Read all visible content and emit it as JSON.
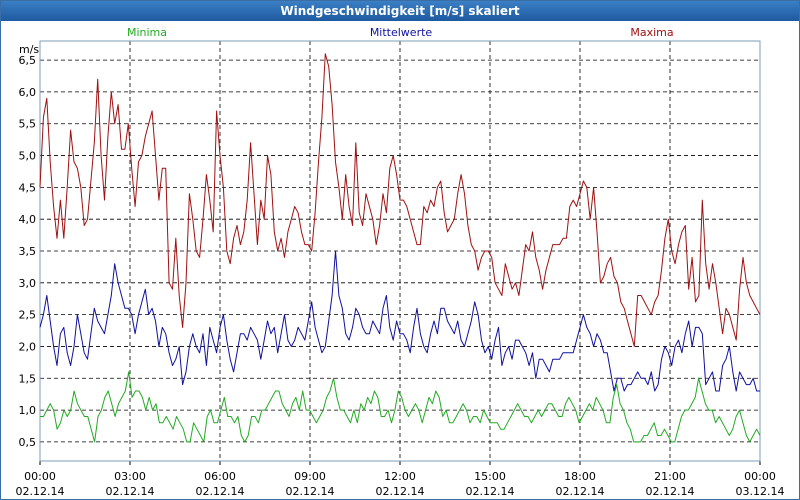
{
  "window": {
    "title": "Windgeschwindigkeit [m/s] skaliert"
  },
  "colors": {
    "minima": "#22aa22",
    "mittelwerte": "#1010a0",
    "maxima": "#a01010",
    "grid": "#000000"
  },
  "chart_data": {
    "type": "line",
    "title": "Windgeschwindigkeit [m/s] skaliert",
    "ylabel": "m/s",
    "xlabel": "",
    "ylim": [
      0.2,
      6.8
    ],
    "xlim": [
      0,
      24
    ],
    "grid": true,
    "legend": [
      "Minima",
      "Mittelwerte",
      "Maxima"
    ],
    "legend_placement": "top",
    "y_ticks": [
      "0,5",
      "1,0",
      "1,5",
      "2,0",
      "2,5",
      "3,0",
      "3,5",
      "4,0",
      "4,5",
      "5,0",
      "5,5",
      "6,0",
      "6,5"
    ],
    "y_tick_values": [
      0.5,
      1.0,
      1.5,
      2.0,
      2.5,
      3.0,
      3.5,
      4.0,
      4.5,
      5.0,
      5.5,
      6.0,
      6.5
    ],
    "x_ticks": [
      {
        "time": "00:00",
        "date": "02.12.14"
      },
      {
        "time": "03:00",
        "date": "02.12.14"
      },
      {
        "time": "06:00",
        "date": "02.12.14"
      },
      {
        "time": "09:00",
        "date": "02.12.14"
      },
      {
        "time": "12:00",
        "date": "02.12.14"
      },
      {
        "time": "15:00",
        "date": "02.12.14"
      },
      {
        "time": "18:00",
        "date": "02.12.14"
      },
      {
        "time": "21:00",
        "date": "02.12.14"
      },
      {
        "time": "00:00",
        "date": "03.12.14"
      }
    ],
    "x_tick_values": [
      0,
      3,
      6,
      9,
      12,
      15,
      18,
      21,
      24
    ],
    "sample_interval_minutes": 10,
    "series": [
      {
        "name": "Maxima",
        "color": "#a01010",
        "values": [
          4.5,
          5.6,
          5.9,
          4.9,
          4.2,
          3.7,
          4.3,
          3.7,
          4.5,
          5.4,
          4.9,
          4.8,
          4.5,
          3.9,
          4.0,
          4.6,
          5.2,
          6.2,
          5.0,
          4.3,
          5.3,
          6.0,
          5.5,
          5.8,
          5.1,
          5.1,
          5.5,
          4.8,
          4.2,
          4.9,
          5.0,
          5.3,
          5.5,
          5.7,
          5.0,
          4.3,
          4.8,
          4.8,
          3.0,
          2.9,
          3.7,
          2.8,
          2.3,
          3.0,
          4.4,
          4.0,
          3.5,
          3.4,
          4.0,
          4.7,
          4.3,
          3.8,
          5.7,
          5.0,
          4.5,
          3.5,
          3.3,
          3.7,
          3.9,
          3.6,
          3.8,
          4.3,
          5.2,
          4.4,
          3.6,
          4.3,
          4.0,
          5.0,
          4.7,
          3.8,
          3.5,
          3.7,
          3.4,
          3.8,
          4.0,
          4.2,
          4.1,
          3.8,
          3.6,
          3.6,
          3.5,
          4.1,
          4.9,
          5.6,
          6.6,
          6.4,
          5.8,
          4.9,
          4.5,
          4.0,
          4.7,
          4.2,
          3.9,
          5.2,
          4.1,
          3.9,
          4.4,
          4.2,
          4.0,
          3.6,
          3.9,
          4.4,
          4.1,
          4.8,
          5.0,
          4.7,
          4.3,
          4.3,
          4.2,
          4.0,
          3.8,
          3.6,
          3.6,
          4.2,
          4.1,
          4.3,
          4.2,
          4.5,
          4.6,
          4.1,
          3.8,
          3.9,
          4.0,
          4.4,
          4.7,
          4.4,
          3.9,
          3.6,
          3.5,
          3.2,
          3.4,
          3.5,
          3.5,
          3.4,
          3.0,
          2.9,
          2.8,
          3.3,
          3.1,
          2.9,
          3.0,
          2.8,
          3.2,
          3.6,
          3.5,
          3.8,
          3.4,
          3.2,
          2.9,
          3.2,
          3.4,
          3.6,
          3.6,
          3.6,
          3.7,
          3.7,
          4.2,
          4.3,
          4.2,
          4.4,
          4.6,
          4.5,
          4.0,
          4.5,
          3.8,
          3.0,
          3.1,
          3.3,
          3.4,
          3.1,
          3.0,
          2.7,
          2.6,
          2.4,
          2.2,
          2.0,
          2.8,
          2.8,
          2.7,
          2.6,
          2.5,
          2.7,
          2.8,
          3.2,
          3.7,
          4.0,
          3.5,
          3.3,
          3.6,
          3.8,
          3.9,
          2.9,
          3.4,
          2.7,
          2.8,
          4.3,
          3.3,
          2.9,
          3.3,
          3.0,
          2.6,
          2.2,
          2.6,
          2.5,
          2.3,
          2.1,
          2.9,
          3.4,
          3.0,
          2.8,
          2.7,
          2.6,
          2.5
        ]
      },
      {
        "name": "Mittelwerte",
        "color": "#1010a0",
        "values": [
          2.3,
          2.5,
          2.8,
          2.4,
          2.0,
          1.7,
          2.2,
          2.3,
          1.9,
          1.7,
          2.0,
          2.5,
          2.2,
          1.9,
          1.8,
          2.2,
          2.6,
          2.4,
          2.3,
          2.2,
          2.5,
          2.8,
          3.3,
          3.0,
          2.8,
          2.6,
          2.6,
          2.5,
          2.2,
          2.5,
          2.7,
          2.9,
          2.5,
          2.6,
          2.4,
          2.0,
          2.3,
          2.2,
          1.9,
          1.7,
          1.8,
          2.0,
          1.4,
          1.6,
          2.0,
          2.2,
          2.0,
          1.9,
          2.2,
          1.7,
          2.3,
          2.1,
          1.9,
          2.3,
          2.5,
          2.1,
          1.8,
          1.6,
          1.9,
          2.2,
          2.2,
          2.1,
          2.3,
          2.2,
          2.1,
          1.8,
          2.1,
          2.4,
          2.2,
          2.3,
          1.9,
          2.2,
          2.5,
          2.1,
          2.0,
          2.1,
          2.3,
          2.2,
          2.1,
          2.4,
          2.7,
          2.3,
          2.1,
          1.9,
          2.0,
          2.4,
          2.8,
          3.5,
          2.8,
          2.6,
          2.2,
          2.1,
          2.3,
          2.6,
          2.5,
          2.3,
          2.2,
          2.2,
          2.4,
          2.3,
          2.2,
          2.6,
          2.8,
          2.3,
          2.1,
          2.4,
          2.2,
          2.2,
          2.1,
          1.9,
          2.3,
          2.6,
          2.2,
          2.0,
          1.9,
          2.2,
          2.4,
          2.2,
          2.6,
          2.6,
          2.4,
          2.3,
          2.2,
          2.4,
          2.1,
          2.0,
          2.2,
          2.4,
          2.7,
          2.5,
          2.1,
          1.9,
          2.0,
          1.8,
          2.1,
          2.3,
          1.7,
          1.9,
          2.0,
          1.8,
          2.1,
          2.1,
          2.0,
          1.9,
          1.7,
          1.9,
          1.5,
          1.8,
          1.8,
          1.7,
          1.6,
          1.8,
          1.8,
          1.8,
          1.9,
          1.9,
          1.9,
          1.9,
          2.1,
          2.3,
          2.5,
          2.3,
          2.2,
          2.0,
          2.2,
          2.1,
          1.9,
          1.9,
          1.6,
          1.3,
          1.5,
          1.5,
          1.3,
          1.4,
          1.4,
          1.5,
          1.6,
          1.5,
          1.5,
          1.4,
          1.6,
          1.3,
          1.4,
          1.8,
          2.0,
          1.9,
          1.7,
          2.0,
          2.1,
          1.9,
          2.2,
          2.4,
          2.0,
          2.3,
          2.3,
          2.2,
          1.4,
          1.5,
          1.6,
          1.3,
          1.3,
          1.7,
          1.8,
          2.0,
          1.6,
          1.3,
          1.6,
          1.5,
          1.4,
          1.4,
          1.5,
          1.3,
          1.3
        ]
      },
      {
        "name": "Minima",
        "color": "#22aa22",
        "values": [
          0.9,
          0.9,
          1.0,
          1.1,
          1.0,
          0.7,
          0.8,
          1.0,
          0.9,
          1.0,
          1.3,
          1.1,
          1.0,
          0.9,
          0.9,
          0.7,
          0.5,
          0.9,
          1.0,
          1.2,
          1.3,
          1.1,
          0.9,
          1.1,
          1.2,
          1.3,
          1.6,
          1.2,
          1.3,
          1.3,
          1.2,
          1.0,
          1.2,
          1.0,
          1.1,
          0.8,
          0.8,
          0.9,
          0.8,
          0.7,
          0.9,
          0.8,
          0.7,
          0.5,
          0.5,
          0.8,
          0.7,
          0.6,
          0.5,
          0.9,
          1.0,
          0.8,
          0.8,
          1.0,
          1.2,
          0.9,
          0.9,
          0.8,
          0.9,
          0.6,
          0.5,
          0.6,
          0.9,
          0.9,
          0.8,
          1.0,
          1.0,
          1.1,
          1.2,
          1.3,
          1.3,
          1.1,
          1.0,
          0.9,
          1.1,
          1.2,
          1.0,
          1.3,
          1.0,
          1.0,
          0.9,
          0.8,
          0.9,
          1.0,
          1.2,
          1.3,
          1.5,
          1.2,
          1.0,
          1.0,
          0.9,
          0.8,
          1.0,
          0.8,
          1.1,
          1.0,
          1.2,
          1.1,
          1.3,
          1.2,
          0.9,
          0.9,
          1.0,
          0.8,
          1.0,
          1.3,
          1.2,
          1.0,
          0.9,
          1.0,
          1.1,
          1.0,
          0.8,
          1.0,
          1.2,
          1.1,
          1.3,
          1.2,
          0.9,
          1.0,
          0.8,
          0.8,
          0.9,
          1.0,
          1.1,
          1.0,
          0.8,
          0.9,
          0.9,
          0.8,
          1.0,
          0.9,
          0.8,
          0.8,
          0.8,
          0.7,
          0.7,
          0.8,
          0.9,
          1.0,
          1.1,
          1.0,
          0.9,
          0.9,
          0.8,
          0.9,
          1.0,
          0.9,
          1.0,
          1.1,
          1.1,
          1.0,
          0.9,
          0.9,
          1.1,
          1.2,
          1.1,
          1.0,
          0.8,
          0.9,
          1.0,
          1.1,
          1.0,
          1.2,
          1.1,
          1.0,
          0.8,
          0.8,
          1.2,
          1.4,
          1.1,
          1.0,
          0.8,
          0.7,
          0.5,
          0.5,
          0.5,
          0.6,
          0.6,
          0.7,
          0.8,
          0.6,
          0.6,
          0.7,
          0.6,
          0.5,
          0.5,
          0.7,
          0.9,
          1.0,
          1.0,
          1.1,
          1.2,
          1.5,
          1.3,
          1.1,
          1.0,
          1.0,
          0.8,
          0.9,
          0.8,
          0.7,
          0.6,
          0.7,
          0.9,
          1.0,
          0.8,
          0.6,
          0.5,
          0.6,
          0.7,
          0.6
        ]
      }
    ]
  }
}
